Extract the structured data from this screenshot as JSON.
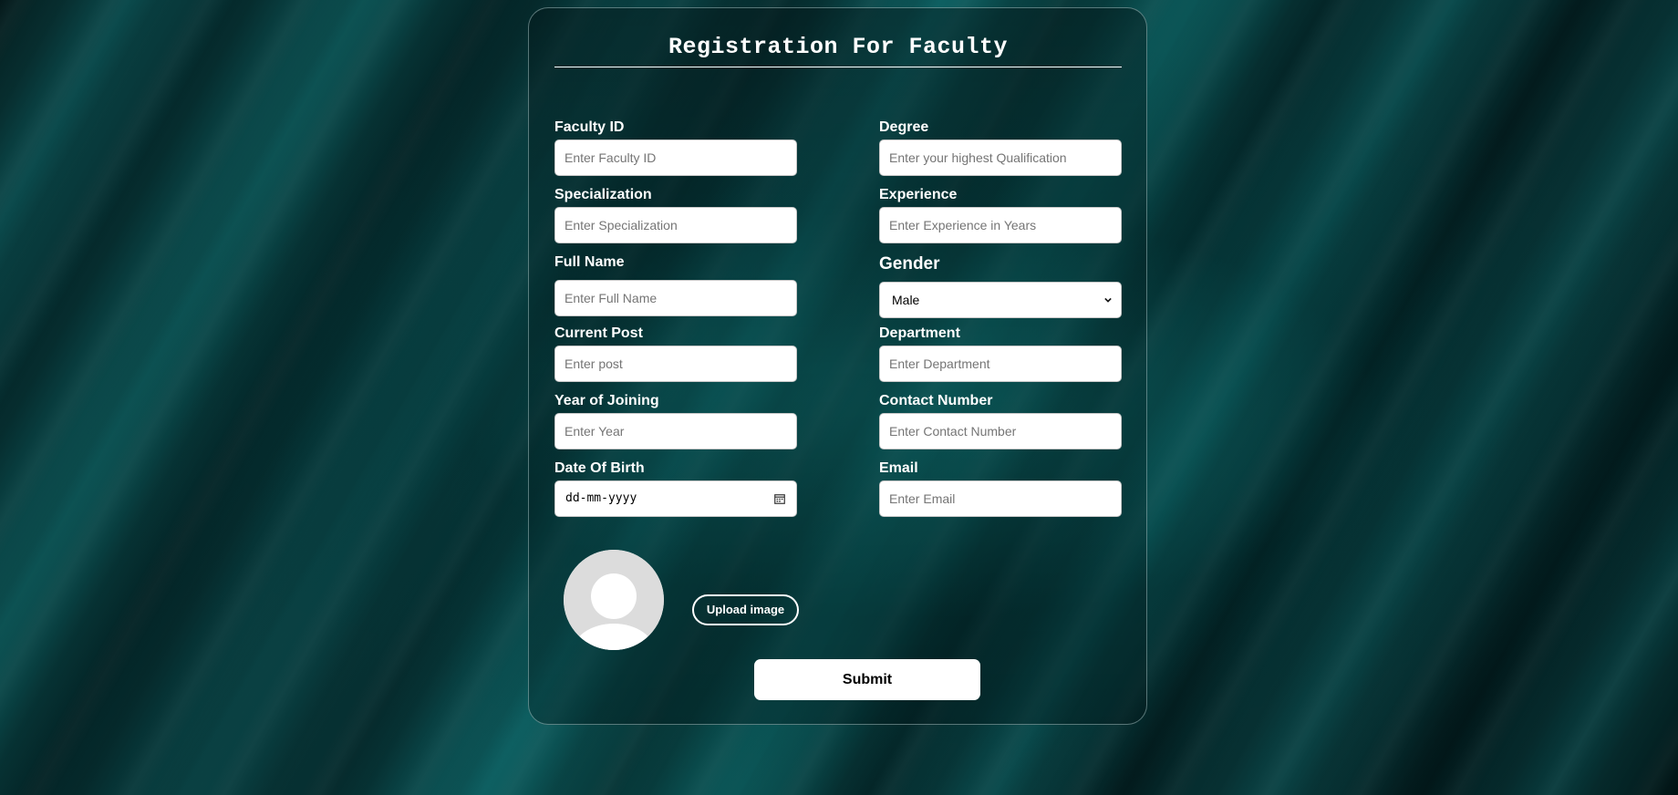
{
  "form": {
    "title": "Registration For Faculty",
    "fields": {
      "faculty_id": {
        "label": "Faculty ID",
        "placeholder": "Enter Faculty ID"
      },
      "degree": {
        "label": "Degree",
        "placeholder": "Enter your highest Qualification"
      },
      "specialization": {
        "label": "Specialization",
        "placeholder": "Enter Specialization"
      },
      "experience": {
        "label": "Experience",
        "placeholder": "Enter Experience in Years"
      },
      "full_name": {
        "label": "Full Name",
        "placeholder": "Enter Full Name"
      },
      "gender": {
        "label": "Gender",
        "selected": "Male"
      },
      "current_post": {
        "label": "Current Post",
        "placeholder": "Enter post"
      },
      "department": {
        "label": "Department",
        "placeholder": "Enter Department"
      },
      "year_of_joining": {
        "label": "Year of Joining",
        "placeholder": "Enter Year"
      },
      "contact_number": {
        "label": "Contact Number",
        "placeholder": "Enter Contact Number"
      },
      "date_of_birth": {
        "label": "Date Of Birth",
        "placeholder": "dd-mm-yyyy"
      },
      "email": {
        "label": "Email",
        "placeholder": "Enter Email"
      }
    },
    "upload_label": "Upload image",
    "submit_label": "Submit"
  },
  "icons": {
    "avatar": "user-avatar-icon",
    "calendar": "calendar-icon",
    "select": "chevron-down-icon"
  },
  "colors": {
    "card_border": "#bedcdc",
    "input_bg": "#ffffff",
    "placeholder": "#757575",
    "avatar_placeholder": "#dcdcdc"
  }
}
